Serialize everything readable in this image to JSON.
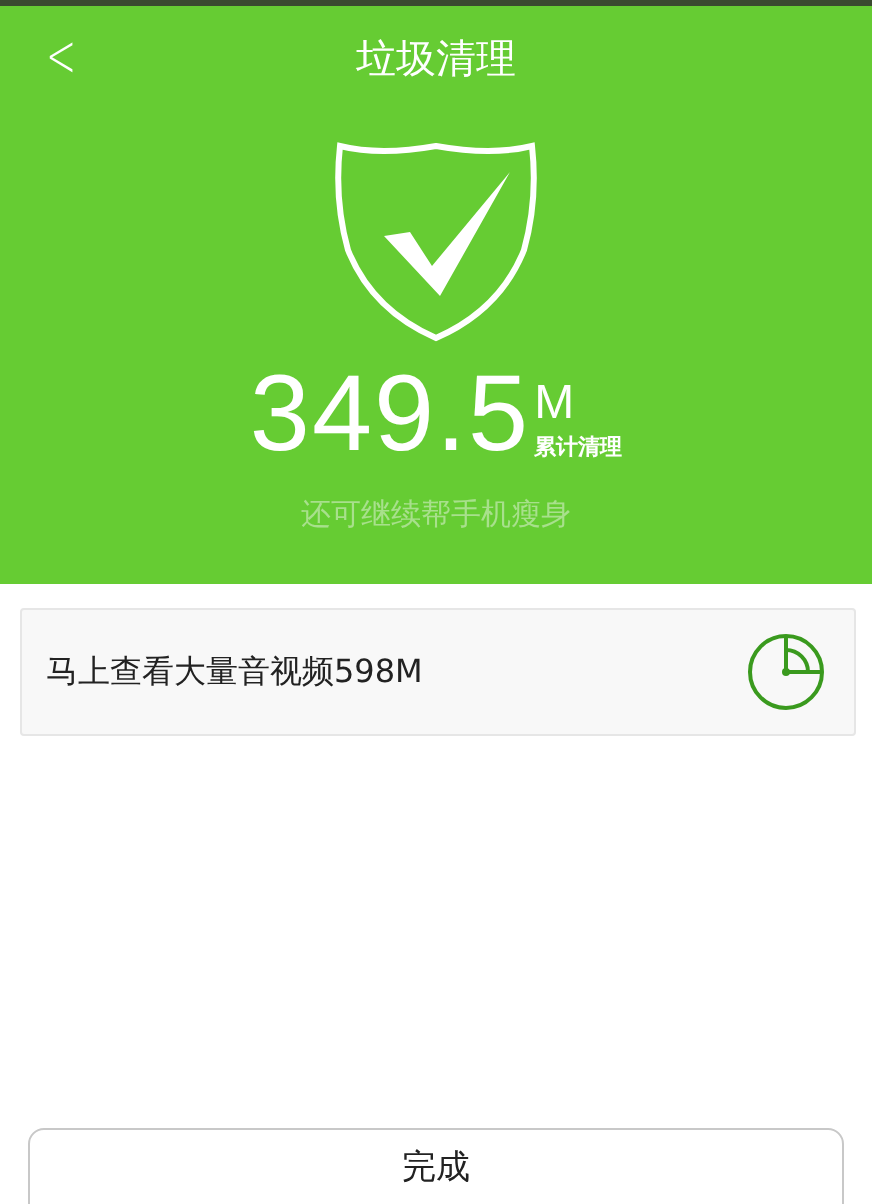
{
  "header": {
    "back": "<",
    "title": "垃圾清理",
    "amount": "349.5",
    "unit": "M",
    "amount_label": "累计清理",
    "subtitle": "还可继续帮手机瘦身"
  },
  "suggestion": {
    "text": "马上查看大量音视频598M"
  },
  "buttons": [
    {
      "label": "完成"
    }
  ]
}
